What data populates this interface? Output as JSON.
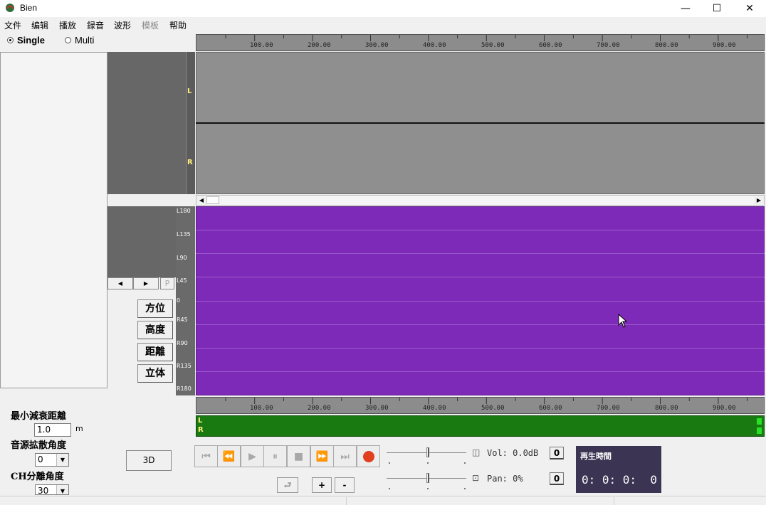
{
  "window": {
    "title": "Bien",
    "controls": {
      "minimize": "—",
      "maximize": "☐",
      "close": "✕"
    }
  },
  "menu": {
    "items": [
      {
        "label": "文件",
        "enabled": true
      },
      {
        "label": "编辑",
        "enabled": true
      },
      {
        "label": "播放",
        "enabled": true
      },
      {
        "label": "録音",
        "enabled": true
      },
      {
        "label": "波形",
        "enabled": true
      },
      {
        "label": "模板",
        "enabled": false
      },
      {
        "label": "帮助",
        "enabled": true
      }
    ]
  },
  "mode": {
    "single_label": "Single",
    "multi_label": "Multi",
    "selected": "Single"
  },
  "waveform": {
    "channel_left": "L",
    "channel_right": "R"
  },
  "ruler": {
    "ticks": [
      "100.00",
      "200.00",
      "300.00",
      "400.00",
      "500.00",
      "600.00",
      "700.00",
      "800.00",
      "900.00"
    ]
  },
  "pan_axis": {
    "labels": [
      "L180",
      "L135",
      "L90",
      "L45",
      "0",
      "R45",
      "R90",
      "R135",
      "R180"
    ]
  },
  "pan_nav": {
    "prev": "◀",
    "next": "▶",
    "p": "P"
  },
  "mode_buttons": {
    "azimuth": "方位",
    "elevation": "高度",
    "distance": "距離",
    "stereo": "立体"
  },
  "meter": {
    "left_label": "L",
    "right_label": "R"
  },
  "settings": {
    "min_distance_label": "最小減衰距離",
    "min_distance_value": "1.0",
    "min_distance_unit": "m",
    "spread_label": "音源拡散角度",
    "spread_value": "0",
    "ch_sep_label": "CH分離角度",
    "ch_sep_value": "30",
    "combo_arrow": "▼"
  },
  "view_3d_label": "3D",
  "transport": {
    "first": "⏮",
    "rewind": "⏪",
    "play": "▶",
    "pause": "⏸",
    "stop": "■",
    "forward": "⏩",
    "last": "⏭",
    "loop": "⮐",
    "plus": "+",
    "minus": "-"
  },
  "volume": {
    "readout": "Vol: 0.0dB",
    "reset_label": "0",
    "icon": "◫"
  },
  "pan": {
    "readout": "Pan: 0%",
    "reset_label": "0",
    "icon": "⊡"
  },
  "playtime": {
    "label": "再生時間",
    "value": "0: 0: 0:  0"
  }
}
